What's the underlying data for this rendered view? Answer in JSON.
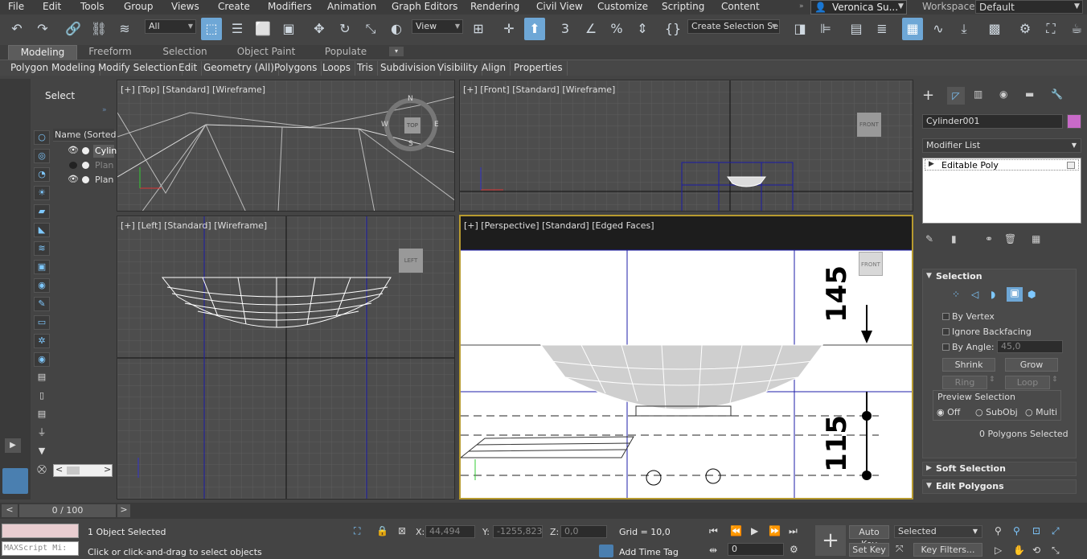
{
  "menubar": {
    "items": [
      "File",
      "Edit",
      "Tools",
      "Group",
      "Views",
      "Create",
      "Modifiers",
      "Animation",
      "Graph Editors",
      "Rendering",
      "Civil View",
      "Customize",
      "Scripting",
      "Content"
    ],
    "user": "Veronica Su...",
    "workspaces_label": "Workspaces:",
    "workspace_value": "Default"
  },
  "toolbar": {
    "filter_value": "All",
    "refcoord_value": "View",
    "selection_set_placeholder": "Create Selection Se"
  },
  "ribbon": {
    "tabs": [
      "Modeling",
      "Freeform",
      "Selection",
      "Object Paint",
      "Populate"
    ],
    "active_tab": "Modeling",
    "buttons": [
      "Polygon Modeling",
      "Modify Selection",
      "Edit",
      "Geometry (All)",
      "Polygons",
      "Loops",
      "Tris",
      "Subdivision",
      "Visibility",
      "Align",
      "Properties"
    ]
  },
  "scene_explorer": {
    "title": "Select",
    "column_header": "Name (Sorted A",
    "items": [
      "Cylin",
      "Plan",
      "Plan"
    ]
  },
  "viewports": {
    "top": {
      "label": "[+] [Top] [Standard] [Wireframe]",
      "cube": "TOP",
      "compass": [
        "N",
        "S",
        "W",
        "E"
      ]
    },
    "front": {
      "label": "[+] [Front] [Standard] [Wireframe]",
      "cube": "FRONT"
    },
    "left": {
      "label": "[+] [Left] [Standard] [Wireframe]",
      "cube": "LEFT"
    },
    "perspective": {
      "label": "[+] [Perspective] [Standard] [Edged Faces]",
      "cube": "FRONT",
      "dim_top": "145",
      "dim_bottom": "115"
    }
  },
  "command_panel": {
    "object_name": "Cylinder001",
    "object_color": "#c86ac8",
    "modifier_list_label": "Modifier List",
    "modifier_stack": [
      "Editable Poly"
    ],
    "selection_rollout": {
      "title": "Selection",
      "by_vertex": "By Vertex",
      "ignore_backfacing": "Ignore Backfacing",
      "by_angle": "By Angle:",
      "angle_value": "45,0",
      "shrink": "Shrink",
      "grow": "Grow",
      "ring": "Ring",
      "loop": "Loop",
      "preview_title": "Preview Selection",
      "preview_options": [
        "Off",
        "SubObj",
        "Multi"
      ],
      "status": "0 Polygons Selected"
    },
    "soft_selection": "Soft Selection",
    "edit_polygons": "Edit Polygons"
  },
  "timeline": {
    "frame": "0 / 100"
  },
  "status": {
    "maxscript_placeholder": "MAXScript Mi:",
    "objects_selected": "1 Object Selected",
    "prompt": "Click or click-and-drag to select objects",
    "x_label": "X:",
    "x_value": "44,494",
    "y_label": "Y:",
    "y_value": "-1255,823",
    "z_label": "Z:",
    "z_value": "0,0",
    "grid": "Grid = 10,0",
    "add_time_tag": "Add Time Tag",
    "auto_key": "Auto Key",
    "set_key": "Set Key",
    "key_mode": "Selected",
    "key_filters": "Key Filters...",
    "frame_field": "0"
  }
}
